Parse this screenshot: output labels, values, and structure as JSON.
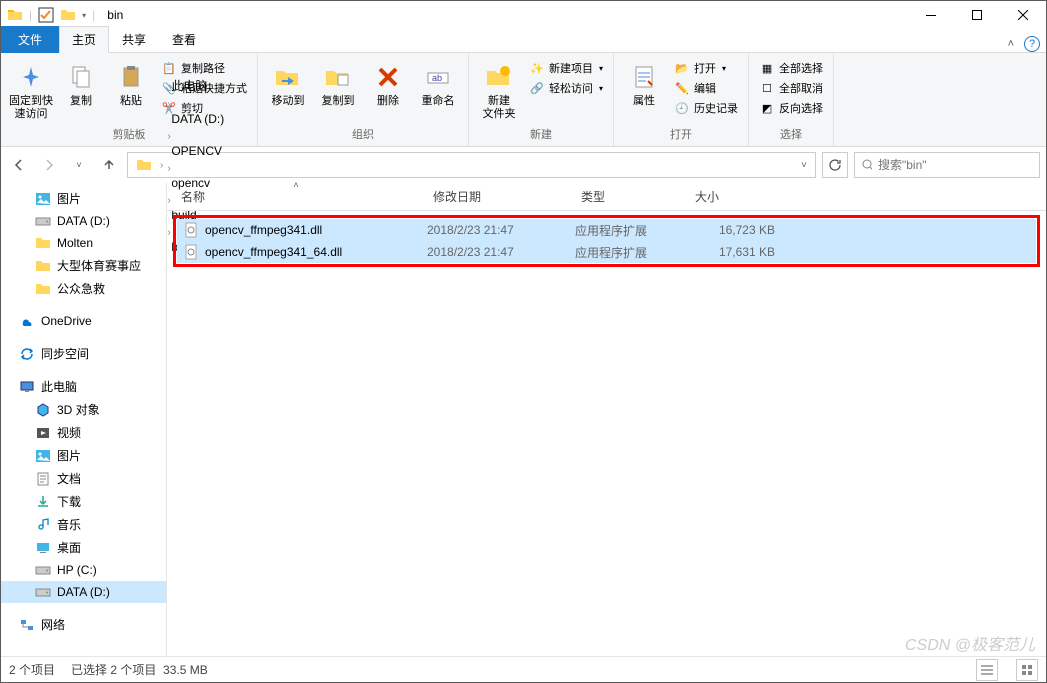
{
  "title": "bin",
  "tabs": {
    "file": "文件",
    "home": "主页",
    "share": "共享",
    "view": "查看"
  },
  "ribbon": {
    "clipboard": {
      "pin": "固定到快\n速访问",
      "copy": "复制",
      "paste": "粘贴",
      "cut": "剪切",
      "copypath": "复制路径",
      "pasteshort": "粘贴快捷方式",
      "label": "剪贴板"
    },
    "organize": {
      "moveto": "移动到",
      "copyto": "复制到",
      "delete": "删除",
      "rename": "重命名",
      "label": "组织"
    },
    "new": {
      "newfolder": "新建\n文件夹",
      "newitem": "新建项目",
      "easyaccess": "轻松访问",
      "label": "新建"
    },
    "open": {
      "props": "属性",
      "open": "打开",
      "edit": "编辑",
      "history": "历史记录",
      "label": "打开"
    },
    "select": {
      "all": "全部选择",
      "none": "全部取消",
      "invert": "反向选择",
      "label": "选择"
    }
  },
  "breadcrumb": [
    "此电脑",
    "DATA (D:)",
    "OPENCV",
    "opencv",
    "build",
    "bin"
  ],
  "search_placeholder": "搜索\"bin\"",
  "columns": {
    "name": "名称",
    "date": "修改日期",
    "type": "类型",
    "size": "大小"
  },
  "sidebar": [
    {
      "label": "图片",
      "icon": "picture",
      "depth": 1
    },
    {
      "label": "DATA (D:)",
      "icon": "drive",
      "depth": 1
    },
    {
      "label": "Molten",
      "icon": "folder",
      "depth": 1
    },
    {
      "label": "大型体育赛事应",
      "icon": "folder",
      "depth": 1
    },
    {
      "label": "公众急救",
      "icon": "folder",
      "depth": 1
    },
    {
      "gap": true
    },
    {
      "label": "OneDrive",
      "icon": "onedrive",
      "depth": 0
    },
    {
      "gap": true
    },
    {
      "label": "同步空间",
      "icon": "sync",
      "depth": 0
    },
    {
      "gap": true
    },
    {
      "label": "此电脑",
      "icon": "thispc",
      "depth": 0
    },
    {
      "label": "3D 对象",
      "icon": "3d",
      "depth": 1
    },
    {
      "label": "视频",
      "icon": "video",
      "depth": 1
    },
    {
      "label": "图片",
      "icon": "picture",
      "depth": 1
    },
    {
      "label": "文档",
      "icon": "docs",
      "depth": 1
    },
    {
      "label": "下载",
      "icon": "download",
      "depth": 1
    },
    {
      "label": "音乐",
      "icon": "music",
      "depth": 1
    },
    {
      "label": "桌面",
      "icon": "desktop",
      "depth": 1
    },
    {
      "label": "HP (C:)",
      "icon": "drive",
      "depth": 1
    },
    {
      "label": "DATA (D:)",
      "icon": "drive",
      "depth": 1,
      "selected": true
    },
    {
      "gap": true
    },
    {
      "label": "网络",
      "icon": "network",
      "depth": 0
    }
  ],
  "files": [
    {
      "name": "opencv_ffmpeg341.dll",
      "date": "2018/2/23 21:47",
      "type": "应用程序扩展",
      "size": "16,723 KB"
    },
    {
      "name": "opencv_ffmpeg341_64.dll",
      "date": "2018/2/23 21:47",
      "type": "应用程序扩展",
      "size": "17,631 KB"
    }
  ],
  "status": {
    "count": "2 个项目",
    "selected": "已选择 2 个项目",
    "size": "33.5 MB"
  },
  "watermark": "CSDN @极客范儿"
}
